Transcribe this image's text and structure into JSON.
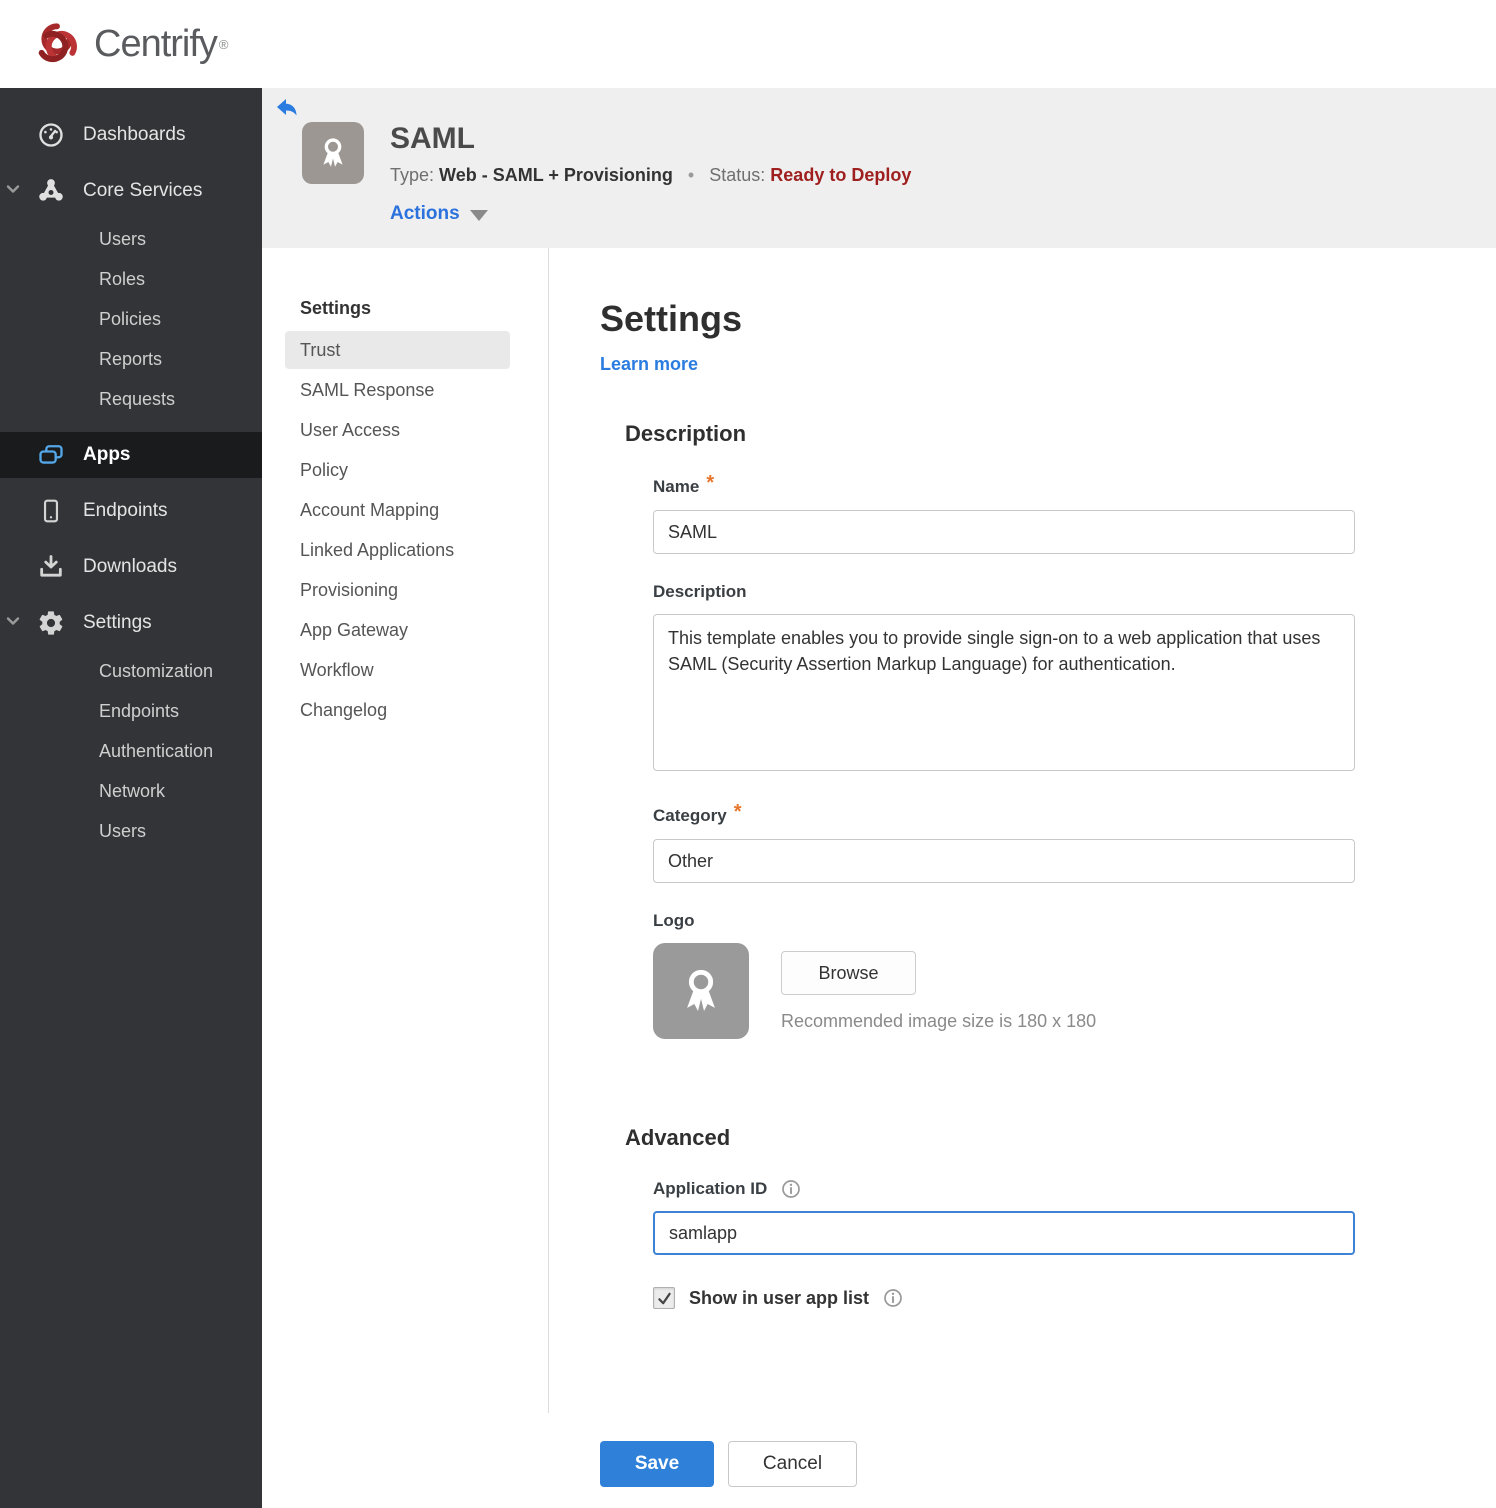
{
  "brand": {
    "name": "Centrify",
    "trademark": "®"
  },
  "sidebar": {
    "items": [
      {
        "label": "Dashboards",
        "icon": "gauge-icon"
      },
      {
        "label": "Core Services",
        "icon": "core-services-icon",
        "expanded": true,
        "children": [
          "Users",
          "Roles",
          "Policies",
          "Reports",
          "Requests"
        ]
      },
      {
        "label": "Apps",
        "icon": "apps-icon",
        "active": true
      },
      {
        "label": "Endpoints",
        "icon": "mobile-icon"
      },
      {
        "label": "Downloads",
        "icon": "download-icon"
      },
      {
        "label": "Settings",
        "icon": "gear-icon",
        "expanded": true,
        "children": [
          "Customization",
          "Endpoints",
          "Authentication",
          "Network",
          "Users"
        ]
      }
    ]
  },
  "app_header": {
    "title": "SAML",
    "type_label": "Type:",
    "type_value": "Web - SAML + Provisioning",
    "separator": "•",
    "status_label": "Status:",
    "status_value": "Ready to Deploy",
    "actions_label": "Actions"
  },
  "subnav": {
    "heading": "Settings",
    "active_item": "Trust",
    "items": [
      "Trust",
      "SAML Response",
      "User Access",
      "Policy",
      "Account Mapping",
      "Linked Applications",
      "Provisioning",
      "App Gateway",
      "Workflow",
      "Changelog"
    ]
  },
  "content": {
    "title": "Settings",
    "learn_more": "Learn more",
    "required_marker": "*",
    "description_section": {
      "heading": "Description",
      "name_label": "Name",
      "name_value": "SAML",
      "description_label": "Description",
      "description_value": "This template enables you to provide single sign-on to a web application that uses SAML (Security Assertion Markup Language) for authentication.",
      "category_label": "Category",
      "category_value": "Other",
      "logo_label": "Logo",
      "browse_label": "Browse",
      "logo_hint": "Recommended image size is 180 x 180"
    },
    "advanced_section": {
      "heading": "Advanced",
      "app_id_label": "Application ID",
      "app_id_value": "samlapp",
      "app_id_focused": true,
      "checkbox_label": "Show in user app list",
      "checkbox_checked": true
    },
    "footer": {
      "save_label": "Save",
      "cancel_label": "Cancel"
    }
  },
  "colors": {
    "sidebar_bg": "#323437",
    "sidebar_active_bg": "#191b1d",
    "band_bg": "#efeff0",
    "accent_blue": "#2b7ce0",
    "save_blue": "#2e80d9",
    "status_red": "#9e1f1d",
    "required_orange": "#e8752c",
    "apps_icon_blue": "#54a7e8",
    "logo_red": "#b02e31"
  }
}
